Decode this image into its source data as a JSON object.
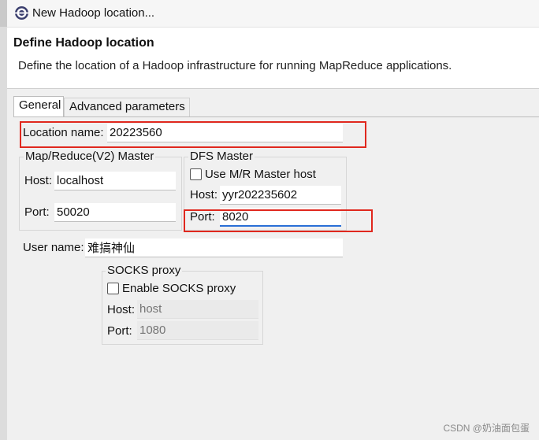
{
  "window": {
    "title": "New Hadoop location..."
  },
  "header": {
    "title": "Define Hadoop location",
    "description": "Define the location of a Hadoop infrastructure for running MapReduce applications."
  },
  "tabs": [
    {
      "label": "General",
      "selected": true
    },
    {
      "label": "Advanced parameters",
      "selected": false
    }
  ],
  "general": {
    "location_name_label": "Location name:",
    "location_name_value": "20223560",
    "mr_master": {
      "title": "Map/Reduce(V2) Master",
      "host_label": "Host:",
      "host_value": "localhost",
      "port_label": "Port:",
      "port_value": "50020"
    },
    "dfs_master": {
      "title": "DFS Master",
      "use_mr_label": "Use M/R Master host",
      "use_mr_checked": false,
      "host_label": "Host:",
      "host_value": "yyr202235602",
      "port_label": "Port:",
      "port_value": "8020"
    },
    "user_name_label": "User name:",
    "user_name_value": "难搞神仙",
    "socks": {
      "title": "SOCKS proxy",
      "enable_label": "Enable SOCKS proxy",
      "enable_checked": false,
      "host_label": "Host:",
      "host_placeholder": "host",
      "port_label": "Port:",
      "port_placeholder": "1080"
    }
  },
  "watermark": "CSDN @奶油面包蛋",
  "colors": {
    "highlight_box": "#e0281e",
    "focus_underline": "#2a6fd6"
  }
}
